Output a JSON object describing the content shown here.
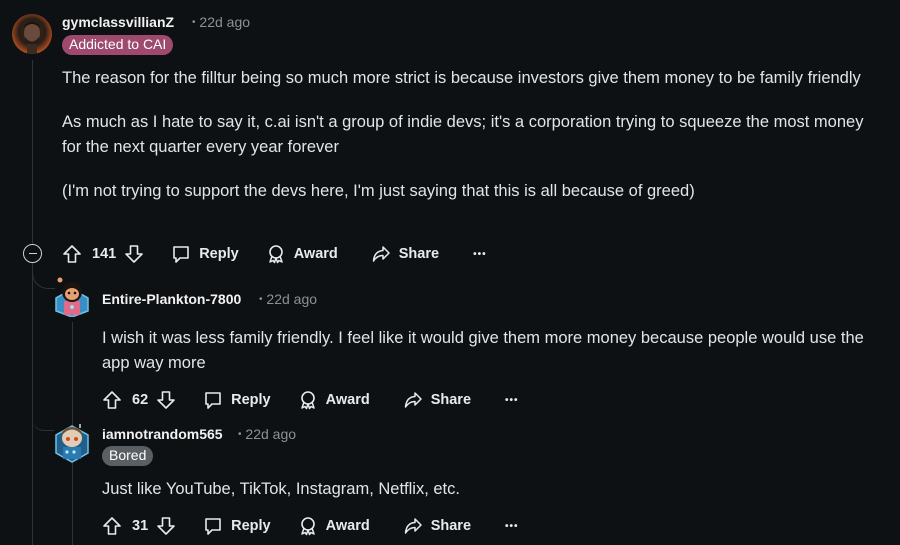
{
  "comments": [
    {
      "username": "gymclassvillianZ",
      "time": "22d ago",
      "flair": "Addicted to CAI",
      "flair_color": "#9e4a6e",
      "paragraphs": [
        "The reason for the filltur being so much more strict is because investors give them money to be family friendly",
        "As much as I hate to say it, c.ai isn't a group of indie devs; it's a corporation trying to squeeze the most money for the next quarter every year forever",
        "(I'm not trying to support the devs here, I'm just saying that this is all because of greed)"
      ],
      "score": "141",
      "reply_label": "Reply",
      "award_label": "Award",
      "share_label": "Share",
      "more_label": "•••"
    },
    {
      "username": "Entire-Plankton-7800",
      "time": "22d ago",
      "paragraphs": [
        "I wish it was less family friendly. I feel like it would give them more money because people would use the app way more"
      ],
      "score": "62",
      "reply_label": "Reply",
      "award_label": "Award",
      "share_label": "Share",
      "more_label": "•••"
    },
    {
      "username": "iamnotrandom565",
      "time": "22d ago",
      "flair": "Bored",
      "flair_color": "#5a5f63",
      "paragraphs": [
        "Just like YouTube, TikTok, Instagram, Netflix, etc."
      ],
      "score": "31",
      "reply_label": "Reply",
      "award_label": "Award",
      "share_label": "Share",
      "more_label": "•••"
    }
  ],
  "separator": "•"
}
